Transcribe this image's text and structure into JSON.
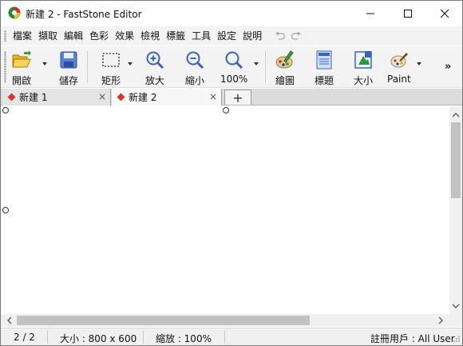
{
  "window": {
    "title": "新建 2 - FastStone Editor"
  },
  "menu": {
    "items": [
      "檔案",
      "擷取",
      "編輯",
      "色彩",
      "效果",
      "檢視",
      "標籤",
      "工具",
      "設定",
      "說明"
    ]
  },
  "toolbar": {
    "open": "開啟",
    "save": "儲存",
    "rectangle": "矩形",
    "zoom_in": "放大",
    "zoom_out": "縮小",
    "zoom_100": "100%",
    "draw": "繪圖",
    "caption": "標題",
    "resize": "大小",
    "paint": "Paint",
    "overflow": "»"
  },
  "tabs": [
    {
      "label": "新建 1",
      "close": "×"
    },
    {
      "label": "新建 2",
      "close": "×"
    }
  ],
  "tab_add": "+",
  "status": {
    "page": "2 / 2",
    "size": "大小 : 800 x 600",
    "zoom": "縮放 : 100%",
    "user": "註冊用戶 : All User"
  },
  "colors": {
    "tab_marker": "#d9342b",
    "toolbar_blue": "#3a62c4"
  }
}
